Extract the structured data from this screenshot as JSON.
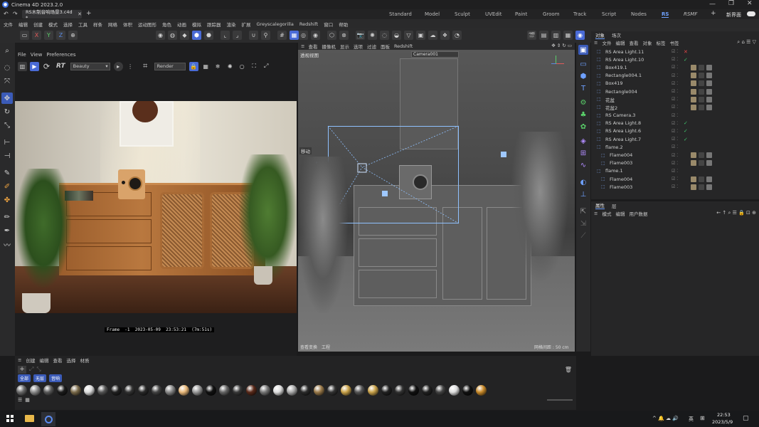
{
  "window": {
    "title": "Cinema 4D 2023.2.0",
    "doc_tab": "RS木制音响场景3.c4d *"
  },
  "layout_tabs": [
    "Standard",
    "Model",
    "Sculpt",
    "UVEdit",
    "Paint",
    "Groom",
    "Track",
    "Script",
    "Nodes",
    "RS",
    "RSMF"
  ],
  "active_layout_tab": "RS",
  "new_interface_label": "新界面",
  "main_menu": [
    "文件",
    "编辑",
    "创建",
    "模式",
    "选择",
    "工具",
    "样条",
    "网格",
    "体积",
    "运动图形",
    "角色",
    "动画",
    "模拟",
    "跟踪器",
    "渲染",
    "扩展",
    "Greyscalegorilla",
    "Redshift",
    "窗口",
    "帮助"
  ],
  "render_view": {
    "menu": [
      "File",
      "View",
      "Preferences"
    ],
    "rt_label": "RT",
    "aov_select": "Beauty",
    "mode_select": "Render",
    "frame_info": "Frame  -1  2023-05-09  23:53:21  (7m:51s)"
  },
  "viewport": {
    "menu": [
      "查看",
      "摄像机",
      "显示",
      "选项",
      "过滤",
      "面板",
      "Redshift"
    ],
    "view_name": "透视视图",
    "camera_label": "Camera001",
    "move_label": "移动",
    "bottom_left": [
      "查看变换",
      "工程"
    ],
    "grid_spacing": "网格间距 : 50 cm"
  },
  "object_manager": {
    "tabs": [
      "对象",
      "场次"
    ],
    "menu": [
      "文件",
      "编辑",
      "查看",
      "对象",
      "标签",
      "书签"
    ],
    "objects": [
      {
        "name": "RS Area Light.11",
        "flag": "✕",
        "flag_color": "#e04646",
        "indent": 0
      },
      {
        "name": "RS Area Light.10",
        "flag": "✓",
        "flag_color": "#3fc46a",
        "indent": 0
      },
      {
        "name": "Box419.1",
        "flag": "",
        "flag_color": "",
        "indent": 0
      },
      {
        "name": "Rectangle004.1",
        "flag": "",
        "flag_color": "",
        "indent": 0
      },
      {
        "name": "Box419",
        "flag": "",
        "flag_color": "",
        "indent": 0
      },
      {
        "name": "Rectangle004",
        "flag": "",
        "flag_color": "",
        "indent": 0
      },
      {
        "name": "花盆",
        "flag": "",
        "flag_color": "",
        "indent": 0
      },
      {
        "name": "花盆2",
        "flag": "",
        "flag_color": "",
        "indent": 0
      },
      {
        "name": "RS Camera.3",
        "flag": "",
        "flag_color": "",
        "indent": 0
      },
      {
        "name": "RS Area Light.8",
        "flag": "✓",
        "flag_color": "#3fc46a",
        "indent": 0
      },
      {
        "name": "RS Area Light.6",
        "flag": "✓",
        "flag_color": "#3fc46a",
        "indent": 0
      },
      {
        "name": "RS Area Light.7",
        "flag": "✓",
        "flag_color": "#3fc46a",
        "indent": 0
      },
      {
        "name": "flame.2",
        "flag": "",
        "flag_color": "",
        "indent": 0
      },
      {
        "name": "Flame004",
        "flag": "",
        "flag_color": "",
        "indent": 1
      },
      {
        "name": "Flame003",
        "flag": "",
        "flag_color": "",
        "indent": 1
      },
      {
        "name": "flame.1",
        "flag": "",
        "flag_color": "",
        "indent": 0
      },
      {
        "name": "Flame004",
        "flag": "",
        "flag_color": "",
        "indent": 1
      },
      {
        "name": "Flame003",
        "flag": "",
        "flag_color": "",
        "indent": 1
      }
    ]
  },
  "attribute_manager": {
    "tabs": [
      "属性",
      "层"
    ],
    "menu": [
      "模式",
      "编辑",
      "用户数据"
    ]
  },
  "material_manager": {
    "menu": [
      "创建",
      "编辑",
      "查看",
      "选择",
      "材质"
    ],
    "filters": [
      "全部",
      "无层",
      "音响"
    ]
  },
  "taskbar": {
    "time": "22:53",
    "date": "2023/5/9",
    "ime": "英"
  }
}
